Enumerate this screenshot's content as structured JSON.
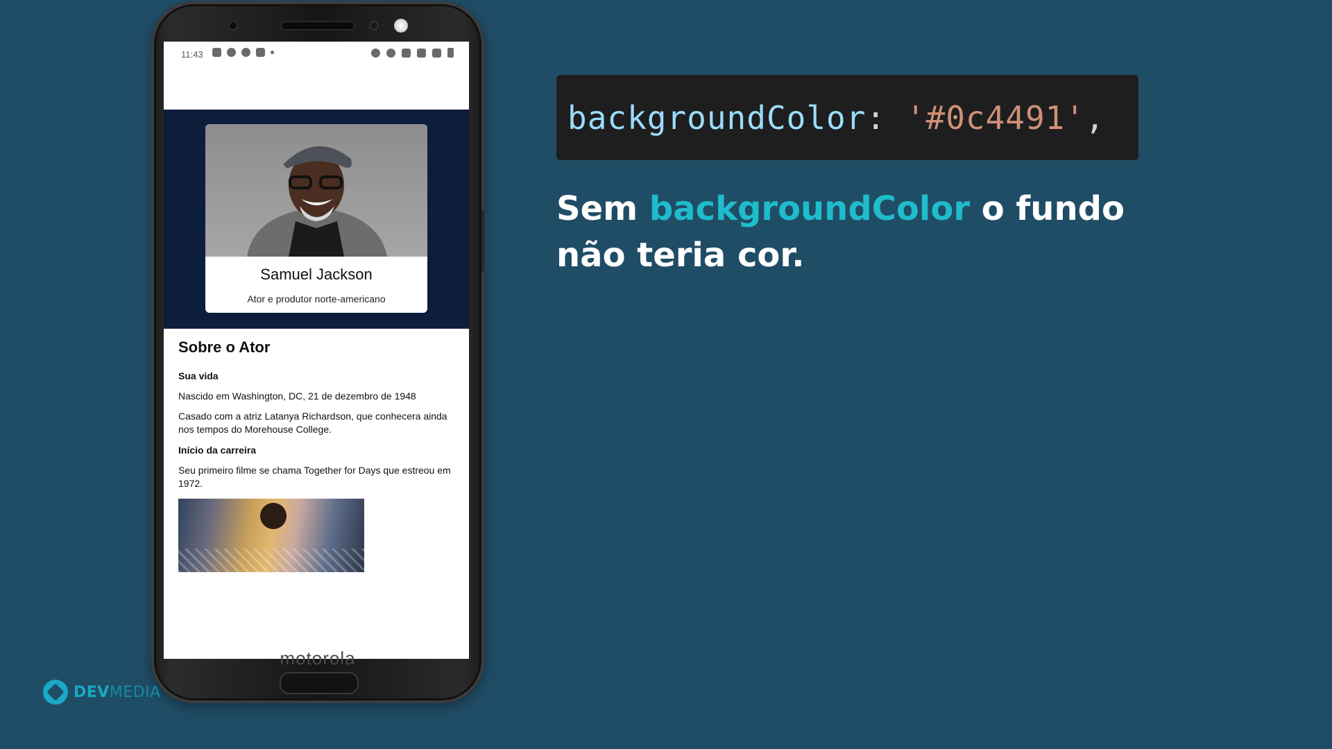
{
  "status_bar": {
    "time": "11:43"
  },
  "phone": {
    "brand": "motorola"
  },
  "card": {
    "name": "Samuel Jackson",
    "subtitle": "Ator e produtor norte-americano"
  },
  "about": {
    "title": "Sobre o Ator",
    "life_heading": "Sua vida",
    "life_p1": "Nascido em Washington, DC, 21 de dezembro de 1948",
    "life_p2": "Casado com a atriz Latanya Richardson, que conhecera ainda nos tempos do Morehouse College.",
    "career_heading": "Início da carreira",
    "career_p1": "Seu primeiro filme se chama Together for Days que estreou em 1972."
  },
  "code": {
    "key": "backgroundColor",
    "colon": ": ",
    "value": "'#0c4491'",
    "trail": ","
  },
  "caption": {
    "before": "Sem ",
    "highlight": "backgroundColor",
    "after": " o fundo não teria cor."
  },
  "logo": {
    "dev": "DEV",
    "media": "MEDIA"
  },
  "colors": {
    "slide_background": "#204d66",
    "header_band": "#0c1e3c",
    "highlight": "#1fbccc"
  }
}
